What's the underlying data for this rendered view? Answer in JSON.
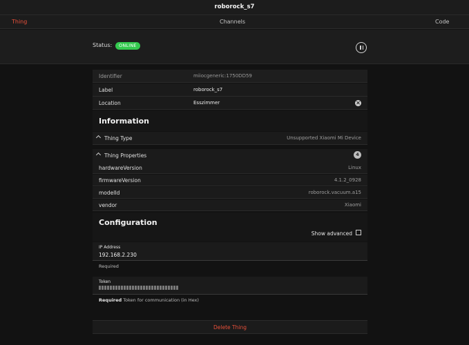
{
  "header": {
    "title": "roborock_s7"
  },
  "tabs": [
    {
      "label": "Thing",
      "active": true
    },
    {
      "label": "Channels",
      "active": false
    },
    {
      "label": "Code",
      "active": false
    }
  ],
  "status": {
    "label": "Status:",
    "badge": "ONLINE",
    "badge_color": "#33c94e"
  },
  "thing": {
    "identifier": {
      "label": "Identifier",
      "value": "miiocgeneric:1750DD59"
    },
    "label": {
      "label": "Label",
      "value": "roborock_s7"
    },
    "location": {
      "label": "Location",
      "value": "Esszimmer"
    }
  },
  "information": {
    "title": "Information",
    "thing_type": {
      "label": "Thing Type",
      "value": "Unsupported Xiaomi Mi Device"
    },
    "properties": {
      "label": "Thing Properties",
      "count": "4",
      "items": [
        {
          "key": "hardwareVersion",
          "value": "Linux"
        },
        {
          "key": "firmwareVersion",
          "value": "4.1.2_0928"
        },
        {
          "key": "modelId",
          "value": "roborock.vacuum.a15"
        },
        {
          "key": "vendor",
          "value": "Xiaomi"
        }
      ]
    }
  },
  "configuration": {
    "title": "Configuration",
    "show_advanced": "Show advanced",
    "ip": {
      "label": "IP Address",
      "value": "192.168.2.230",
      "hint_required": "Required"
    },
    "token": {
      "label": "Token",
      "hint_required": "Required",
      "hint_text": "Token for communication (in Hex)"
    }
  },
  "actions": {
    "delete": "Delete Thing"
  },
  "colors": {
    "accent": "#e8503a",
    "background": "#121212",
    "panel": "#1b1b1b"
  }
}
